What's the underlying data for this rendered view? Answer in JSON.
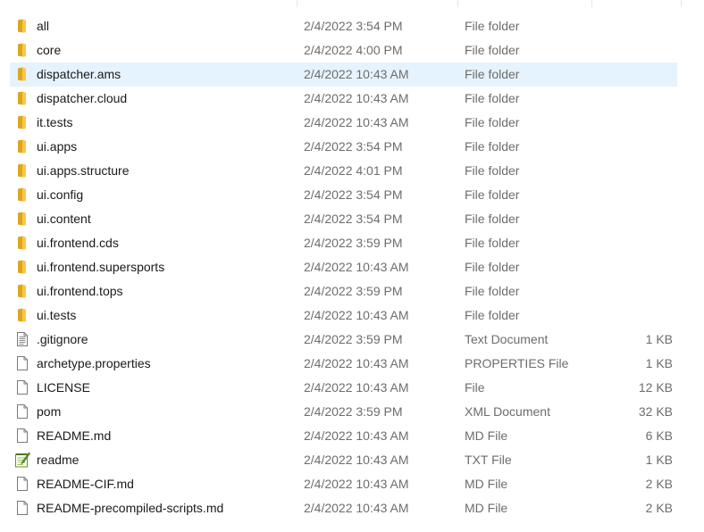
{
  "colors": {
    "selected_row_bg": "#e5f3ff",
    "folder_yellow": "#f8c843",
    "secondary_text": "#6d6d6d"
  },
  "files": [
    {
      "name": "all",
      "date": "2/4/2022 3:54 PM",
      "type": "File folder",
      "size": "",
      "icon": "folder-icon"
    },
    {
      "name": "core",
      "date": "2/4/2022 4:00 PM",
      "type": "File folder",
      "size": "",
      "icon": "folder-icon"
    },
    {
      "name": "dispatcher.ams",
      "date": "2/4/2022 10:43 AM",
      "type": "File folder",
      "size": "",
      "icon": "folder-icon",
      "selected": true
    },
    {
      "name": "dispatcher.cloud",
      "date": "2/4/2022 10:43 AM",
      "type": "File folder",
      "size": "",
      "icon": "folder-icon"
    },
    {
      "name": "it.tests",
      "date": "2/4/2022 10:43 AM",
      "type": "File folder",
      "size": "",
      "icon": "folder-icon"
    },
    {
      "name": "ui.apps",
      "date": "2/4/2022 3:54 PM",
      "type": "File folder",
      "size": "",
      "icon": "folder-icon"
    },
    {
      "name": "ui.apps.structure",
      "date": "2/4/2022 4:01 PM",
      "type": "File folder",
      "size": "",
      "icon": "folder-icon"
    },
    {
      "name": "ui.config",
      "date": "2/4/2022 3:54 PM",
      "type": "File folder",
      "size": "",
      "icon": "folder-icon"
    },
    {
      "name": "ui.content",
      "date": "2/4/2022 3:54 PM",
      "type": "File folder",
      "size": "",
      "icon": "folder-icon"
    },
    {
      "name": "ui.frontend.cds",
      "date": "2/4/2022 3:59 PM",
      "type": "File folder",
      "size": "",
      "icon": "folder-icon"
    },
    {
      "name": "ui.frontend.supersports",
      "date": "2/4/2022 10:43 AM",
      "type": "File folder",
      "size": "",
      "icon": "folder-icon"
    },
    {
      "name": "ui.frontend.tops",
      "date": "2/4/2022 3:59 PM",
      "type": "File folder",
      "size": "",
      "icon": "folder-icon"
    },
    {
      "name": "ui.tests",
      "date": "2/4/2022 10:43 AM",
      "type": "File folder",
      "size": "",
      "icon": "folder-icon"
    },
    {
      "name": ".gitignore",
      "date": "2/4/2022 3:59 PM",
      "type": "Text Document",
      "size": "1 KB",
      "icon": "text-document-icon"
    },
    {
      "name": "archetype.properties",
      "date": "2/4/2022 10:43 AM",
      "type": "PROPERTIES File",
      "size": "1 KB",
      "icon": "file-icon"
    },
    {
      "name": "LICENSE",
      "date": "2/4/2022 10:43 AM",
      "type": "File",
      "size": "12 KB",
      "icon": "file-icon"
    },
    {
      "name": "pom",
      "date": "2/4/2022 3:59 PM",
      "type": "XML Document",
      "size": "32 KB",
      "icon": "file-icon"
    },
    {
      "name": "README.md",
      "date": "2/4/2022 10:43 AM",
      "type": "MD File",
      "size": "6 KB",
      "icon": "file-icon"
    },
    {
      "name": "readme",
      "date": "2/4/2022 10:43 AM",
      "type": "TXT File",
      "size": "1 KB",
      "icon": "notepad-plus-plus-icon"
    },
    {
      "name": "README-CIF.md",
      "date": "2/4/2022 10:43 AM",
      "type": "MD File",
      "size": "2 KB",
      "icon": "file-icon"
    },
    {
      "name": "README-precompiled-scripts.md",
      "date": "2/4/2022 10:43 AM",
      "type": "MD File",
      "size": "2 KB",
      "icon": "file-icon"
    }
  ]
}
